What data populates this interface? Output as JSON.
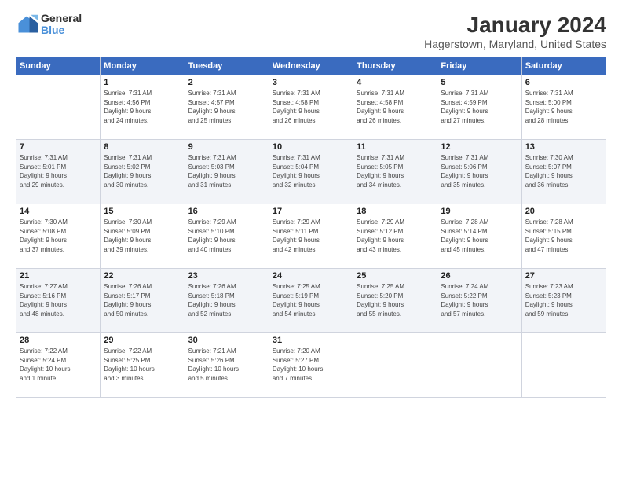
{
  "header": {
    "logo_line1": "General",
    "logo_line2": "Blue",
    "main_title": "January 2024",
    "subtitle": "Hagerstown, Maryland, United States"
  },
  "days_of_week": [
    "Sunday",
    "Monday",
    "Tuesday",
    "Wednesday",
    "Thursday",
    "Friday",
    "Saturday"
  ],
  "weeks": [
    [
      {
        "day": "",
        "info": ""
      },
      {
        "day": "1",
        "info": "Sunrise: 7:31 AM\nSunset: 4:56 PM\nDaylight: 9 hours\nand 24 minutes."
      },
      {
        "day": "2",
        "info": "Sunrise: 7:31 AM\nSunset: 4:57 PM\nDaylight: 9 hours\nand 25 minutes."
      },
      {
        "day": "3",
        "info": "Sunrise: 7:31 AM\nSunset: 4:58 PM\nDaylight: 9 hours\nand 26 minutes."
      },
      {
        "day": "4",
        "info": "Sunrise: 7:31 AM\nSunset: 4:58 PM\nDaylight: 9 hours\nand 26 minutes."
      },
      {
        "day": "5",
        "info": "Sunrise: 7:31 AM\nSunset: 4:59 PM\nDaylight: 9 hours\nand 27 minutes."
      },
      {
        "day": "6",
        "info": "Sunrise: 7:31 AM\nSunset: 5:00 PM\nDaylight: 9 hours\nand 28 minutes."
      }
    ],
    [
      {
        "day": "7",
        "info": "Sunrise: 7:31 AM\nSunset: 5:01 PM\nDaylight: 9 hours\nand 29 minutes."
      },
      {
        "day": "8",
        "info": "Sunrise: 7:31 AM\nSunset: 5:02 PM\nDaylight: 9 hours\nand 30 minutes."
      },
      {
        "day": "9",
        "info": "Sunrise: 7:31 AM\nSunset: 5:03 PM\nDaylight: 9 hours\nand 31 minutes."
      },
      {
        "day": "10",
        "info": "Sunrise: 7:31 AM\nSunset: 5:04 PM\nDaylight: 9 hours\nand 32 minutes."
      },
      {
        "day": "11",
        "info": "Sunrise: 7:31 AM\nSunset: 5:05 PM\nDaylight: 9 hours\nand 34 minutes."
      },
      {
        "day": "12",
        "info": "Sunrise: 7:31 AM\nSunset: 5:06 PM\nDaylight: 9 hours\nand 35 minutes."
      },
      {
        "day": "13",
        "info": "Sunrise: 7:30 AM\nSunset: 5:07 PM\nDaylight: 9 hours\nand 36 minutes."
      }
    ],
    [
      {
        "day": "14",
        "info": "Sunrise: 7:30 AM\nSunset: 5:08 PM\nDaylight: 9 hours\nand 37 minutes."
      },
      {
        "day": "15",
        "info": "Sunrise: 7:30 AM\nSunset: 5:09 PM\nDaylight: 9 hours\nand 39 minutes."
      },
      {
        "day": "16",
        "info": "Sunrise: 7:29 AM\nSunset: 5:10 PM\nDaylight: 9 hours\nand 40 minutes."
      },
      {
        "day": "17",
        "info": "Sunrise: 7:29 AM\nSunset: 5:11 PM\nDaylight: 9 hours\nand 42 minutes."
      },
      {
        "day": "18",
        "info": "Sunrise: 7:29 AM\nSunset: 5:12 PM\nDaylight: 9 hours\nand 43 minutes."
      },
      {
        "day": "19",
        "info": "Sunrise: 7:28 AM\nSunset: 5:14 PM\nDaylight: 9 hours\nand 45 minutes."
      },
      {
        "day": "20",
        "info": "Sunrise: 7:28 AM\nSunset: 5:15 PM\nDaylight: 9 hours\nand 47 minutes."
      }
    ],
    [
      {
        "day": "21",
        "info": "Sunrise: 7:27 AM\nSunset: 5:16 PM\nDaylight: 9 hours\nand 48 minutes."
      },
      {
        "day": "22",
        "info": "Sunrise: 7:26 AM\nSunset: 5:17 PM\nDaylight: 9 hours\nand 50 minutes."
      },
      {
        "day": "23",
        "info": "Sunrise: 7:26 AM\nSunset: 5:18 PM\nDaylight: 9 hours\nand 52 minutes."
      },
      {
        "day": "24",
        "info": "Sunrise: 7:25 AM\nSunset: 5:19 PM\nDaylight: 9 hours\nand 54 minutes."
      },
      {
        "day": "25",
        "info": "Sunrise: 7:25 AM\nSunset: 5:20 PM\nDaylight: 9 hours\nand 55 minutes."
      },
      {
        "day": "26",
        "info": "Sunrise: 7:24 AM\nSunset: 5:22 PM\nDaylight: 9 hours\nand 57 minutes."
      },
      {
        "day": "27",
        "info": "Sunrise: 7:23 AM\nSunset: 5:23 PM\nDaylight: 9 hours\nand 59 minutes."
      }
    ],
    [
      {
        "day": "28",
        "info": "Sunrise: 7:22 AM\nSunset: 5:24 PM\nDaylight: 10 hours\nand 1 minute."
      },
      {
        "day": "29",
        "info": "Sunrise: 7:22 AM\nSunset: 5:25 PM\nDaylight: 10 hours\nand 3 minutes."
      },
      {
        "day": "30",
        "info": "Sunrise: 7:21 AM\nSunset: 5:26 PM\nDaylight: 10 hours\nand 5 minutes."
      },
      {
        "day": "31",
        "info": "Sunrise: 7:20 AM\nSunset: 5:27 PM\nDaylight: 10 hours\nand 7 minutes."
      },
      {
        "day": "",
        "info": ""
      },
      {
        "day": "",
        "info": ""
      },
      {
        "day": "",
        "info": ""
      }
    ]
  ]
}
